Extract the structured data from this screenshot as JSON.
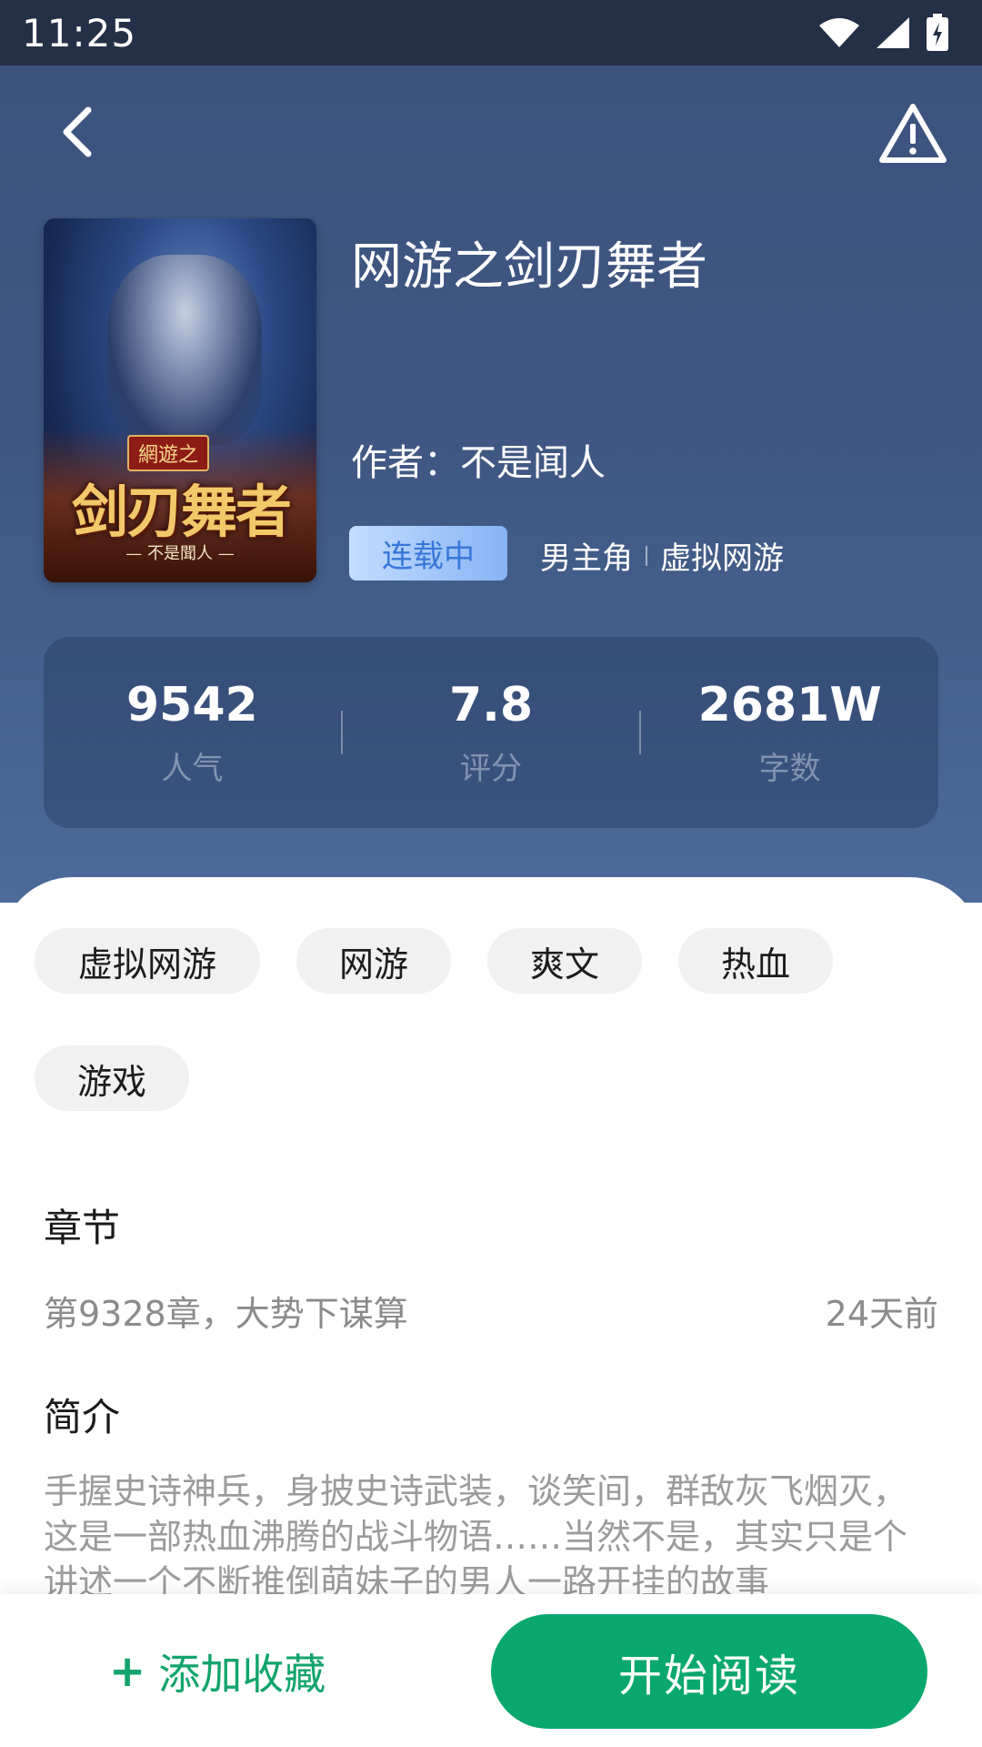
{
  "status_bar": {
    "time": "11:25"
  },
  "book": {
    "title": "网游之剑刃舞者",
    "author_line": "作者：不是闻人",
    "status": "连载中",
    "genres": [
      "男主角",
      "虚拟网游"
    ],
    "cover": {
      "badge": "網遊之",
      "title": "剑刃舞者",
      "author": "— 不是聞人 —"
    }
  },
  "stats": [
    {
      "value": "9542",
      "label": "人气"
    },
    {
      "value": "7.8",
      "label": "评分"
    },
    {
      "value": "2681W",
      "label": "字数"
    }
  ],
  "tags": [
    "虚拟网游",
    "网游",
    "爽文",
    "热血",
    "游戏"
  ],
  "chapter": {
    "heading": "章节",
    "latest": "第9328章，大势下谋算",
    "updated": "24天前"
  },
  "synopsis": {
    "heading": "简介",
    "text": "手握史诗神兵，身披史诗武装，谈笑间，群敌灰飞烟灭，这是一部热血沸腾的战斗物语……当然不是，其实只是个讲述一个不断推倒萌妹子的男人一路开挂的故事"
  },
  "actions": {
    "add_favorite": "添加收藏",
    "start_reading": "开始阅读"
  },
  "colors": {
    "header": "#3f5782",
    "accent": "#0aa86e",
    "status_pill_text": "#3877d9"
  }
}
